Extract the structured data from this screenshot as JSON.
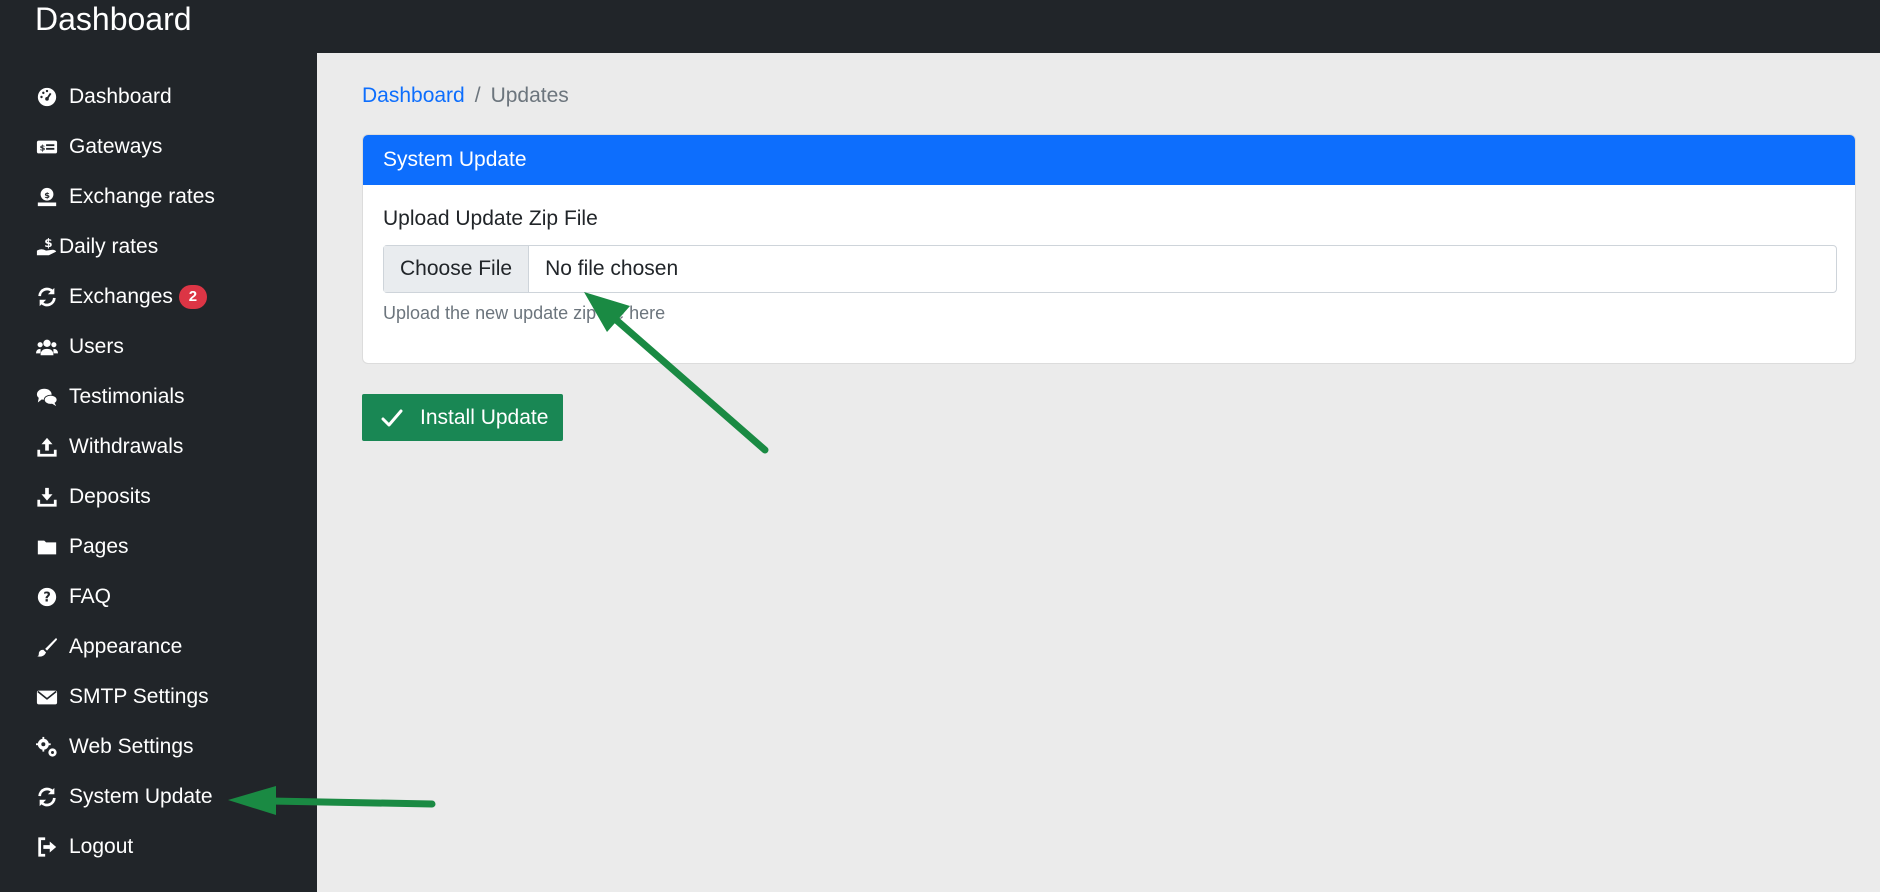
{
  "app": {
    "title": "Dashboard"
  },
  "sidebar": {
    "items": [
      {
        "label": "Dashboard",
        "icon": "tachometer-icon"
      },
      {
        "label": "Gateways",
        "icon": "money-card-icon"
      },
      {
        "label": "Exchange rates",
        "icon": "hand-coin-icon"
      },
      {
        "label": "Daily rates",
        "icon": "hand-dollar-icon"
      },
      {
        "label": "Exchanges",
        "icon": "sync-icon",
        "badge": "2"
      },
      {
        "label": "Users",
        "icon": "users-icon"
      },
      {
        "label": "Testimonials",
        "icon": "comments-icon"
      },
      {
        "label": "Withdrawals",
        "icon": "upload-icon"
      },
      {
        "label": "Deposits",
        "icon": "download-icon"
      },
      {
        "label": "Pages",
        "icon": "folder-icon"
      },
      {
        "label": "FAQ",
        "icon": "question-icon"
      },
      {
        "label": "Appearance",
        "icon": "paint-brush-icon"
      },
      {
        "label": "SMTP Settings",
        "icon": "envelope-icon"
      },
      {
        "label": "Web Settings",
        "icon": "gears-icon"
      },
      {
        "label": "System Update",
        "icon": "sync-icon"
      },
      {
        "label": "Logout",
        "icon": "sign-out-icon"
      }
    ]
  },
  "breadcrumb": {
    "home": "Dashboard",
    "separator": "/",
    "current": "Updates"
  },
  "card": {
    "header": "System Update",
    "field_label": "Upload Update Zip File",
    "choose_button": "Choose File",
    "file_name": "No file chosen",
    "help_text": "Upload the new update zip file here"
  },
  "install_button": {
    "label": "Install Update",
    "icon": "check-icon"
  },
  "colors": {
    "sidebar": "#212529",
    "primary": "#0d6efd",
    "success": "#198754",
    "badge": "#dc3545",
    "annotation_arrow": "#1a8a43",
    "content_bg": "#ebebeb"
  }
}
